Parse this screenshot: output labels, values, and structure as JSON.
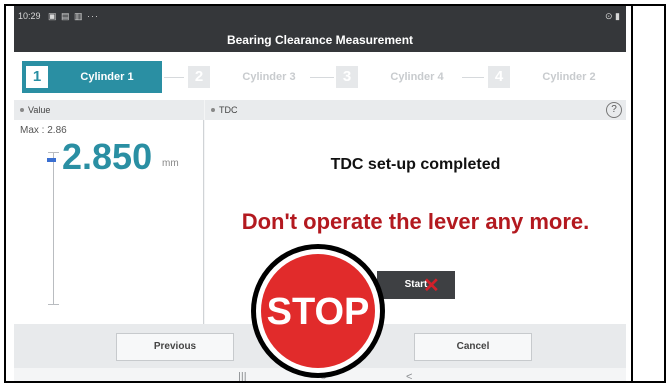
{
  "status_bar": {
    "time": "10:29",
    "icons": "▣ ▤ ▥ ···",
    "right": "⊙ ▮"
  },
  "header": {
    "title": "Bearing Clearance Measurement"
  },
  "steps": [
    {
      "number": "1",
      "label": "Cylinder 1",
      "state": "active"
    },
    {
      "number": "2",
      "label": "Cylinder 3",
      "state": "inactive"
    },
    {
      "number": "3",
      "label": "Cylinder 4",
      "state": "inactive"
    },
    {
      "number": "4",
      "label": "Cylinder 2",
      "state": "inactive"
    }
  ],
  "value_panel": {
    "header": "Value",
    "max_label": "Max : 2.86",
    "value": "2.850",
    "unit": "mm"
  },
  "tdc_panel": {
    "header": "TDC",
    "help_glyph": "?",
    "message": "TDC set-up completed",
    "warning": "Don't operate the lever any more.",
    "start_label": "Start",
    "x_glyph": "✕"
  },
  "footer": {
    "previous_label": "Previous",
    "cancel_label": "Cancel"
  },
  "nav": {
    "recent": "|||",
    "home": "○",
    "back": "<"
  },
  "overlay": {
    "stop_text": "STOP"
  },
  "colors": {
    "accent": "#2a8fa3",
    "warning": "#b3191f",
    "stop_red": "#e12b2b",
    "title_bar": "#35373a"
  }
}
